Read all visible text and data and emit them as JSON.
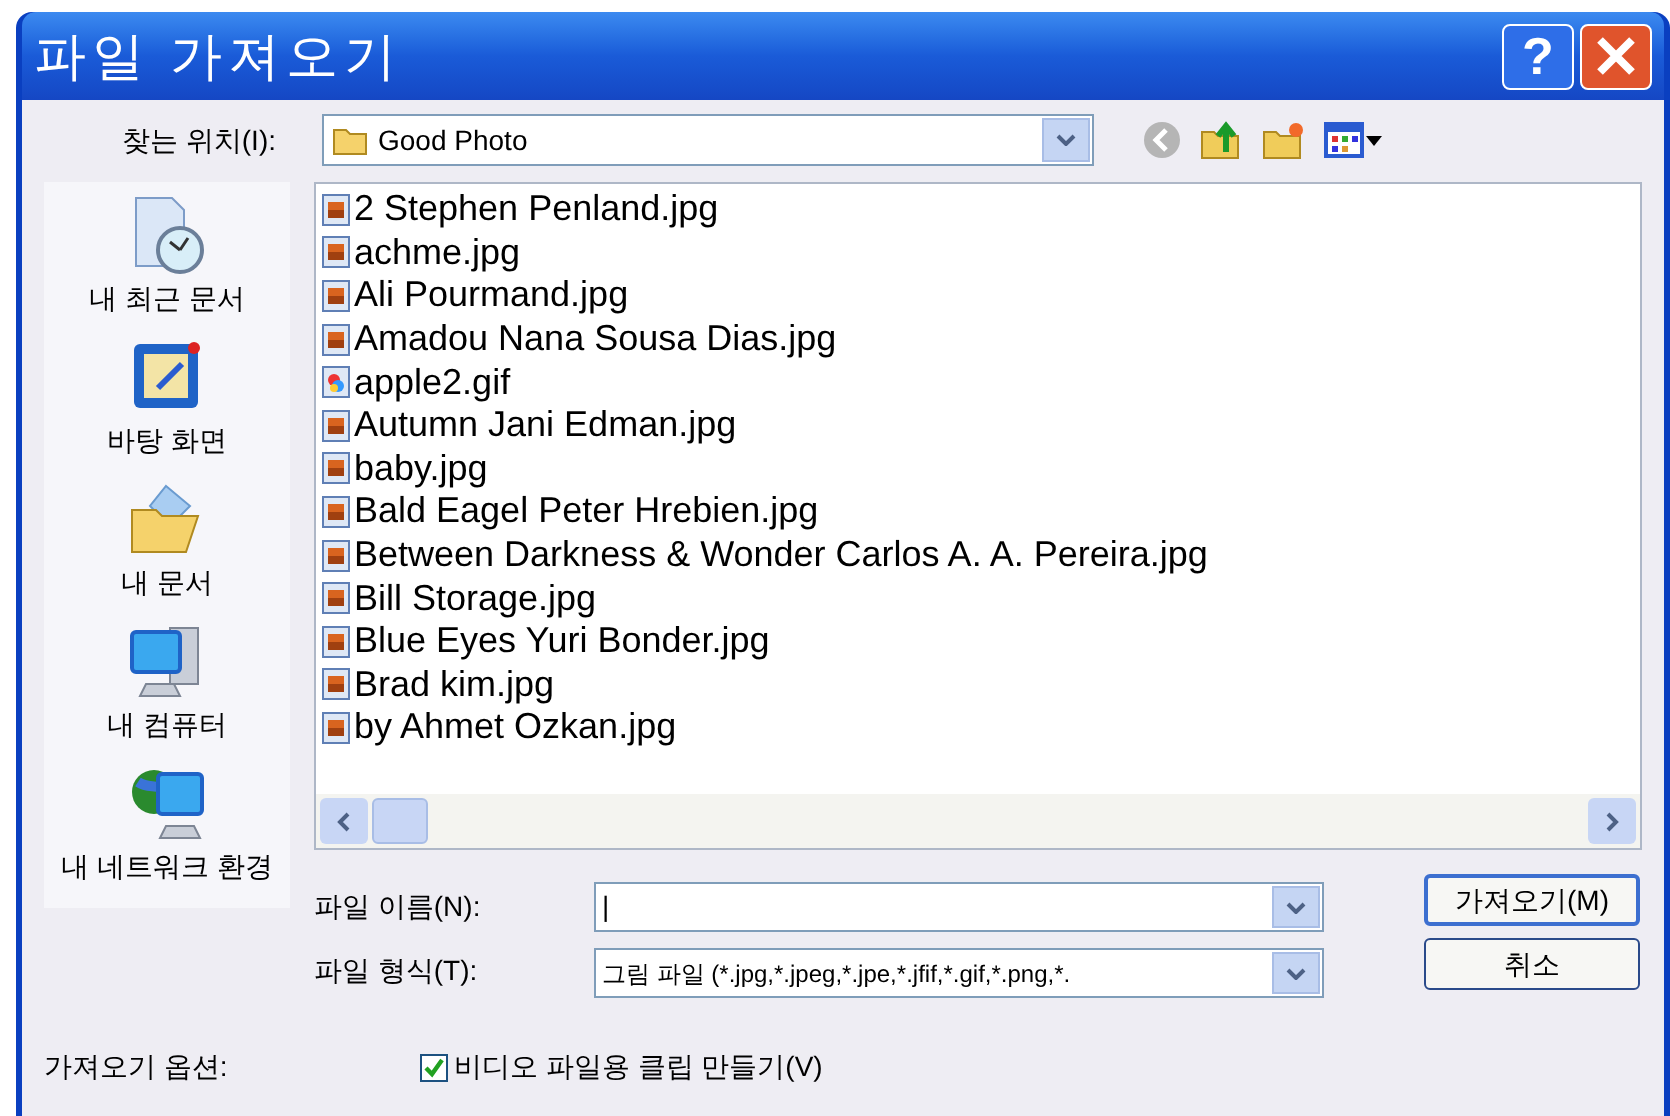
{
  "window": {
    "title": "파일 가져오기",
    "help_button": "?"
  },
  "location": {
    "label": "찾는 위치(I):",
    "value": "Good Photo"
  },
  "places": [
    {
      "kind": "recent",
      "label": "내 최근 문서"
    },
    {
      "kind": "desktop",
      "label": "바탕 화면"
    },
    {
      "kind": "documents",
      "label": "내 문서"
    },
    {
      "kind": "computer",
      "label": "내 컴퓨터"
    },
    {
      "kind": "network",
      "label": "내 네트워크 환경"
    }
  ],
  "files": [
    {
      "kind": "jpg",
      "name": "2 Stephen Penland.jpg"
    },
    {
      "kind": "jpg",
      "name": "achme.jpg"
    },
    {
      "kind": "jpg",
      "name": "Ali Pourmand.jpg"
    },
    {
      "kind": "jpg",
      "name": "Amadou Nana Sousa Dias.jpg"
    },
    {
      "kind": "gif",
      "name": "apple2.gif"
    },
    {
      "kind": "jpg",
      "name": "Autumn Jani Edman.jpg"
    },
    {
      "kind": "jpg",
      "name": "baby.jpg"
    },
    {
      "kind": "jpg",
      "name": "Bald Eagel Peter Hrebien.jpg"
    },
    {
      "kind": "jpg",
      "name": "Between Darkness & Wonder Carlos A. A. Pereira.jpg"
    },
    {
      "kind": "jpg",
      "name": "Bill Storage.jpg"
    },
    {
      "kind": "jpg",
      "name": "Blue Eyes Yuri Bonder.jpg"
    },
    {
      "kind": "jpg",
      "name": "Brad kim.jpg"
    },
    {
      "kind": "jpg",
      "name": "by Ahmet Ozkan.jpg"
    }
  ],
  "file_name": {
    "label": "파일 이름(N):",
    "value": "|"
  },
  "file_type": {
    "label": "파일 형식(T):",
    "value": "그림 파일 (*.jpg,*.jpeg,*.jpe,*.jfif,*.gif,*.png,*."
  },
  "buttons": [
    {
      "kind": "primary",
      "label": "가져오기(M)"
    },
    {
      "kind": "cancel",
      "label": "취소"
    }
  ],
  "options": {
    "label": "가져오기 옵션:",
    "checkbox": {
      "label": "비디오 파일용 클립 만들기(V)",
      "checked": true
    }
  }
}
